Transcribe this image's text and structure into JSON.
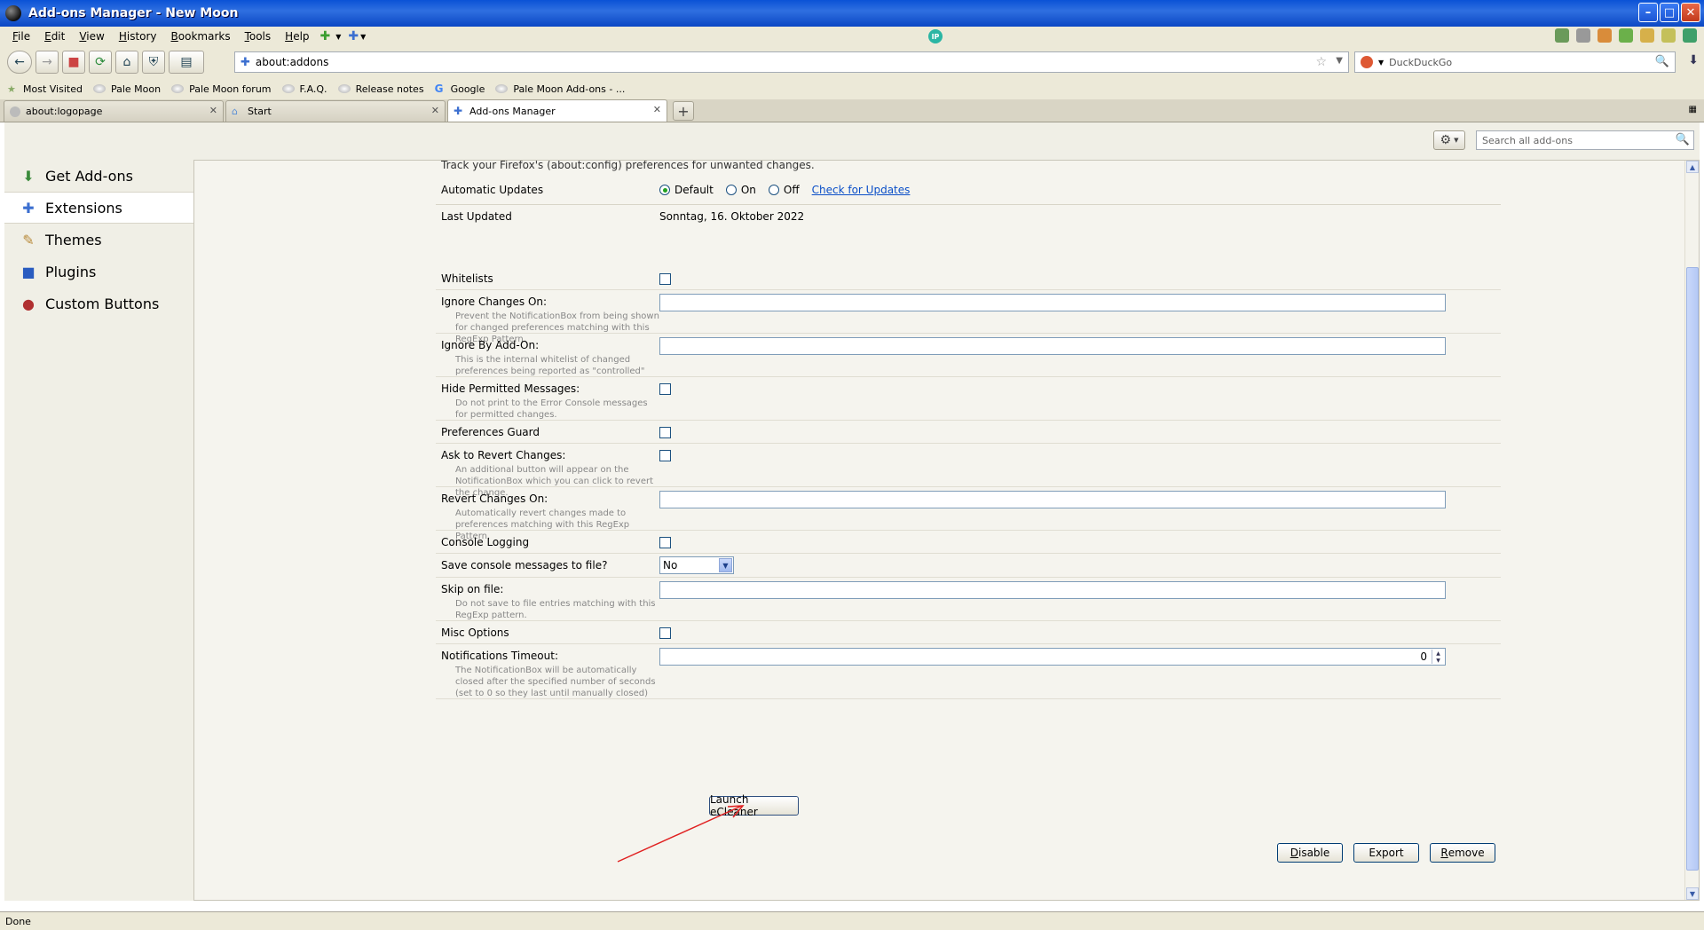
{
  "window": {
    "title": "Add-ons Manager - New Moon"
  },
  "menu": {
    "items": [
      {
        "label": "File",
        "u": "F",
        "rest": "ile"
      },
      {
        "label": "Edit",
        "u": "E",
        "rest": "dit"
      },
      {
        "label": "View",
        "u": "V",
        "rest": "iew"
      },
      {
        "label": "History",
        "u": "H",
        "rest": "istory"
      },
      {
        "label": "Bookmarks",
        "u": "B",
        "rest": "ookmarks"
      },
      {
        "label": "Tools",
        "u": "T",
        "rest": "ools"
      },
      {
        "label": "Help",
        "u": "H",
        "rest": "elp"
      }
    ],
    "ip_badge": "IP"
  },
  "nav": {
    "url": "about:addons",
    "search_placeholder": "DuckDuckGo"
  },
  "bookmarks": [
    {
      "label": "Most Visited",
      "icon": "star-folder-icon"
    },
    {
      "label": "Pale Moon",
      "icon": "pale-moon-icon"
    },
    {
      "label": "Pale Moon forum",
      "icon": "pale-moon-icon"
    },
    {
      "label": "F.A.Q.",
      "icon": "pale-moon-icon"
    },
    {
      "label": "Release notes",
      "icon": "pale-moon-icon"
    },
    {
      "label": "Google",
      "icon": "google-icon"
    },
    {
      "label": "Pale Moon Add-ons - ...",
      "icon": "pale-moon-icon"
    }
  ],
  "tabs": [
    {
      "label": "about:logopage",
      "active": false
    },
    {
      "label": "Start",
      "active": false
    },
    {
      "label": "Add-ons Manager",
      "active": true
    }
  ],
  "addons": {
    "search_placeholder": "Search all add-ons",
    "categories": [
      {
        "label": "Get Add-ons",
        "icon": "download-icon"
      },
      {
        "label": "Extensions",
        "icon": "puzzle-icon",
        "selected": true
      },
      {
        "label": "Themes",
        "icon": "brush-icon"
      },
      {
        "label": "Plugins",
        "icon": "plugin-block-icon"
      },
      {
        "label": "Custom Buttons",
        "icon": "custom-buttons-icon"
      }
    ],
    "description": "Track your Firefox's (about:config) preferences for unwanted changes.",
    "auto_updates": {
      "label": "Automatic Updates",
      "options": [
        "Default",
        "On",
        "Off"
      ],
      "selected": "Default",
      "check_link": "Check for Updates"
    },
    "last_updated": {
      "label": "Last Updated",
      "value": "Sonntag, 16. Oktober 2022"
    },
    "prefs": {
      "whitelists": "Whitelists",
      "ignore_changes_on": {
        "label": "Ignore Changes On:",
        "desc": "Prevent the NotificationBox from being shown for changed preferences matching with this RegExp Pattern.",
        "value": ""
      },
      "ignore_by_addon": {
        "label": "Ignore By Add-On:",
        "desc": "This is the internal whitelist of changed preferences being reported as \"controlled\"",
        "value": ""
      },
      "hide_permitted": {
        "label": "Hide Permitted Messages:",
        "desc": "Do not print to the Error Console messages for permitted changes."
      },
      "preferences_guard": "Preferences Guard",
      "ask_to_revert": {
        "label": "Ask to Revert Changes:",
        "desc": "An additional button will appear on the NotificationBox which you can click to revert the change."
      },
      "revert_changes_on": {
        "label": "Revert Changes On:",
        "desc": "Automatically revert changes made to preferences matching with this RegExp Pattern.",
        "value": ""
      },
      "console_logging": "Console Logging",
      "save_console": {
        "label": "Save console messages to file?",
        "value": "No"
      },
      "skip_on_file": {
        "label": "Skip on file:",
        "desc": "Do not save to file entries matching with this RegExp pattern.",
        "value": ""
      },
      "misc_options": "Misc Options",
      "notif_timeout": {
        "label": "Notifications Timeout:",
        "desc": "The NotificationBox will be automatically closed after the specified number of seconds (set to 0 so they last until manually closed)",
        "value": "0"
      }
    },
    "launch_button": "Launch eCleaner",
    "buttons": {
      "disable": {
        "u": "D",
        "rest": "isable"
      },
      "export": "Export",
      "remove": {
        "u": "R",
        "rest": "emove"
      }
    }
  },
  "status": "Done"
}
